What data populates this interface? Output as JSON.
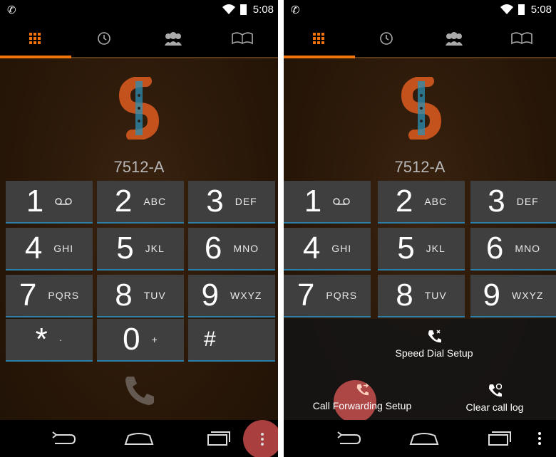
{
  "status_bar": {
    "time": "5:08"
  },
  "tabs": [
    {
      "icon": "dialpad-icon",
      "active": true
    },
    {
      "icon": "recent-clock-icon",
      "active": false
    },
    {
      "icon": "contacts-icon",
      "active": false
    },
    {
      "icon": "address-book-icon",
      "active": false
    }
  ],
  "dialer": {
    "number": "7512-A",
    "keys": [
      {
        "digit": "1",
        "letters": "",
        "icon": "voicemail-icon"
      },
      {
        "digit": "2",
        "letters": "ABC"
      },
      {
        "digit": "3",
        "letters": "DEF"
      },
      {
        "digit": "4",
        "letters": "GHI"
      },
      {
        "digit": "5",
        "letters": "JKL"
      },
      {
        "digit": "6",
        "letters": "MNO"
      },
      {
        "digit": "7",
        "letters": "PQRS"
      },
      {
        "digit": "8",
        "letters": "TUV"
      },
      {
        "digit": "9",
        "letters": "WXYZ"
      },
      {
        "digit": "*",
        "letters": "·"
      },
      {
        "digit": "0",
        "letters": "+"
      },
      {
        "digit": "#",
        "letters": ""
      }
    ]
  },
  "menu": {
    "speed_dial": "Speed Dial Setup",
    "call_forwarding": "Call Forwarding Setup",
    "clear_log": "Clear call log"
  },
  "colors": {
    "accent": "#f0730c",
    "key_bg": "#3f3f3f",
    "key_border": "#2b7fa8",
    "fab": "#c84a4a"
  }
}
